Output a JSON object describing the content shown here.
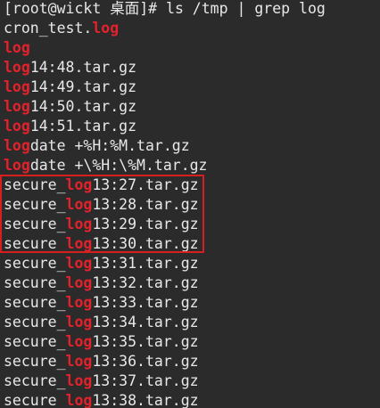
{
  "window": {
    "prompt": "[root@wickt 桌面]# ls /tmp | grep log"
  },
  "colors": {
    "background": "#2b2b2b",
    "text": "#e8e8e8",
    "match_highlight": "#e3222b",
    "annotation_box": "#d61f1f"
  },
  "output": [
    {
      "pre": "cron_test.",
      "match": "log",
      "post": ""
    },
    {
      "pre": "",
      "match": "log",
      "post": ""
    },
    {
      "pre": "",
      "match": "log",
      "post": "14:48.tar.gz"
    },
    {
      "pre": "",
      "match": "log",
      "post": "14:49.tar.gz"
    },
    {
      "pre": "",
      "match": "log",
      "post": "14:50.tar.gz"
    },
    {
      "pre": "",
      "match": "log",
      "post": "14:51.tar.gz"
    },
    {
      "pre": "",
      "match": "log",
      "post": "date +%H:%M.tar.gz"
    },
    {
      "pre": "",
      "match": "log",
      "post": "date +\\%H:\\%M.tar.gz"
    },
    {
      "pre": "secure_",
      "match": "log",
      "post": "13:27.tar.gz"
    },
    {
      "pre": "secure_",
      "match": "log",
      "post": "13:28.tar.gz"
    },
    {
      "pre": "secure_",
      "match": "log",
      "post": "13:29.tar.gz"
    },
    {
      "pre": "secure_",
      "match": "log",
      "post": "13:30.tar.gz"
    },
    {
      "pre": "secure_",
      "match": "log",
      "post": "13:31.tar.gz"
    },
    {
      "pre": "secure_",
      "match": "log",
      "post": "13:32.tar.gz"
    },
    {
      "pre": "secure_",
      "match": "log",
      "post": "13:33.tar.gz"
    },
    {
      "pre": "secure_",
      "match": "log",
      "post": "13:34.tar.gz"
    },
    {
      "pre": "secure_",
      "match": "log",
      "post": "13:35.tar.gz"
    },
    {
      "pre": "secure_",
      "match": "log",
      "post": "13:36.tar.gz"
    },
    {
      "pre": "secure_",
      "match": "log",
      "post": "13:37.tar.gz"
    },
    {
      "pre": "secure_",
      "match": "log",
      "post": "13:38.tar.gz"
    }
  ]
}
